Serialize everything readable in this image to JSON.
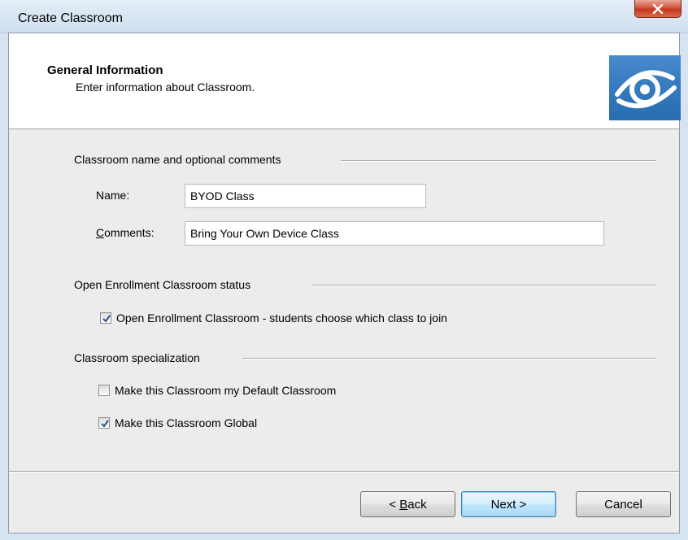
{
  "window": {
    "title": "Create Classroom",
    "close_glyph": "X"
  },
  "header": {
    "title": "General Information",
    "subtitle": "Enter information about Classroom.",
    "logo_icon": "eye-logo-icon"
  },
  "group_name": {
    "heading": "Classroom name and optional comments",
    "name_label": "Name:",
    "name_value": "BYOD Class",
    "comments_label_first": "C",
    "comments_label_rest": "omments:",
    "comments_value": "Bring Your Own Device Class"
  },
  "group_enrollment": {
    "heading": "Open Enrollment Classroom status",
    "open_enrollment_label": "Open Enrollment Classroom - students choose which class to join",
    "open_enrollment_checked": true
  },
  "group_specialization": {
    "heading": "Classroom specialization",
    "default_label": "Make this Classroom my Default Classroom",
    "default_checked": false,
    "global_label": "Make this Classroom Global",
    "global_checked": true
  },
  "buttons": {
    "back_prefix": "< ",
    "back_accel": "B",
    "back_rest": "ack",
    "next": "Next >",
    "cancel": "Cancel"
  },
  "colors": {
    "accent": "#3c7fb1",
    "logo_blue": "#2f78c0",
    "close_red": "#c4381e"
  }
}
